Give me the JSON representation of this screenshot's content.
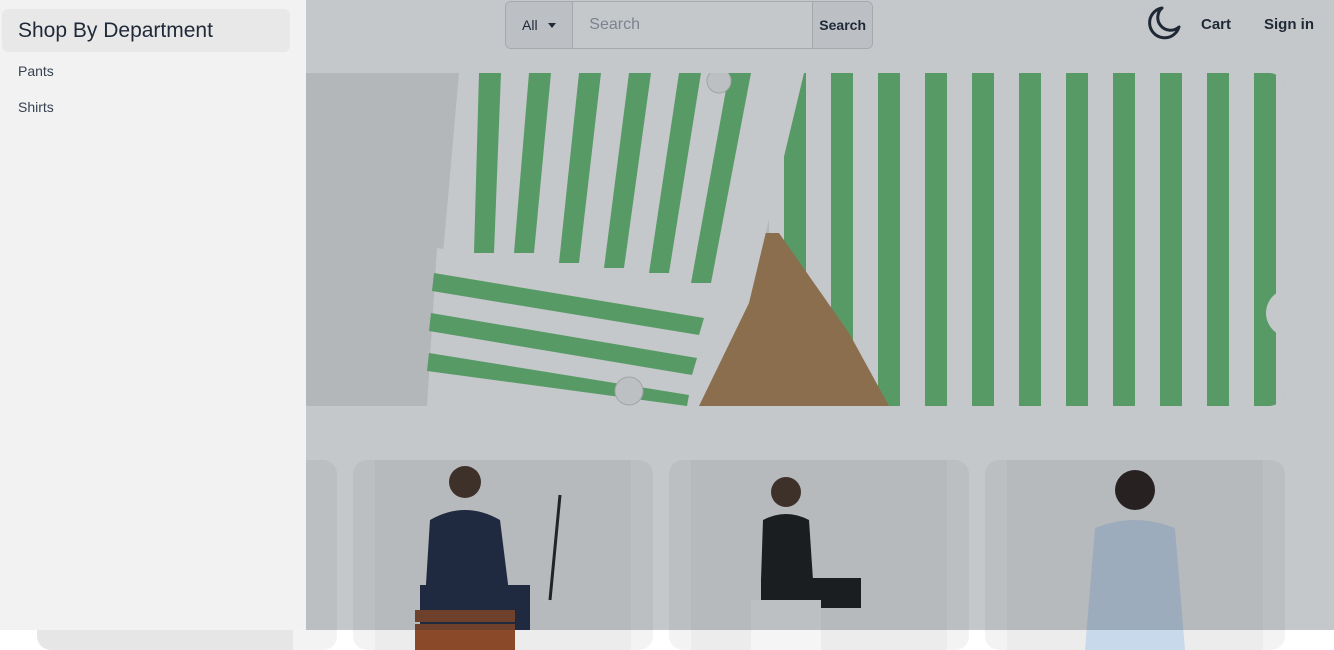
{
  "header": {
    "category_select": "All",
    "search_placeholder": "Search",
    "search_button": "Search",
    "theme_icon": "moon-icon",
    "cart_label": "Cart",
    "signin_label": "Sign in"
  },
  "hero": {
    "next_icon": "chevron-right-icon",
    "next_glyph": "›"
  },
  "products": [
    {
      "name": "product-card"
    },
    {
      "name": "product-card"
    },
    {
      "name": "product-card"
    },
    {
      "name": "product-card"
    }
  ],
  "drawer": {
    "title": "Shop By Department",
    "items": [
      {
        "label": "Pants"
      },
      {
        "label": "Shirts"
      }
    ]
  },
  "colors": {
    "overlay": "#1f2937",
    "drawer_bg": "#f2f2f2",
    "stripe_green": "#6cc177"
  }
}
